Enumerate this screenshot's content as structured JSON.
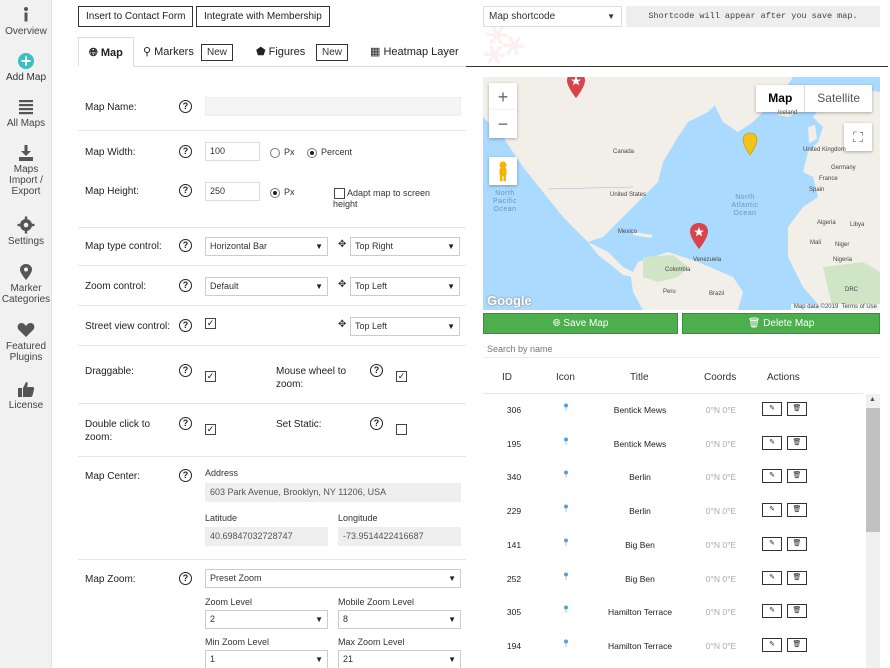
{
  "sidebar": {
    "items": [
      {
        "label": "Overview",
        "icon": "info-icon"
      },
      {
        "label": "Add Map",
        "icon": "plus-circle-icon"
      },
      {
        "label": "All Maps",
        "icon": "list-icon"
      },
      {
        "label": "Maps Import / Export",
        "icon": "download-icon"
      },
      {
        "label": "Settings",
        "icon": "gear-icon"
      },
      {
        "label": "Marker Categories",
        "icon": "map-marker-icon"
      },
      {
        "label": "Featured Plugins",
        "icon": "heart-icon"
      },
      {
        "label": "License",
        "icon": "thumbs-up-icon"
      }
    ]
  },
  "toolbar": {
    "insert_contact_form": "Insert to Contact Form",
    "integrate_membership": "Integrate with Membership"
  },
  "tabs": {
    "map": "Map",
    "markers": "Markers",
    "markers_new": "New",
    "figures": "Figures",
    "figures_new": "New",
    "heatmap": "Heatmap Layer"
  },
  "form": {
    "map_name_label": "Map Name:",
    "map_name_value": "",
    "map_width_label": "Map Width:",
    "map_width_value": "100",
    "map_width_px": "Px",
    "map_width_percent": "Percent",
    "map_height_label": "Map Height:",
    "map_height_value": "250",
    "map_height_px": "Px",
    "adapt_map": "Adapt map to screen height",
    "map_type_control_label": "Map type control:",
    "map_type_control_value": "Horizontal Bar",
    "map_type_control_pos": "Top Right",
    "zoom_control_label": "Zoom control:",
    "zoom_control_value": "Default",
    "zoom_control_pos": "Top Left",
    "street_view_label": "Street view control:",
    "street_view_pos": "Top Left",
    "draggable_label": "Draggable:",
    "mouse_wheel_label": "Mouse wheel to zoom:",
    "double_click_label": "Double click to zoom:",
    "set_static_label": "Set Static:",
    "map_center_label": "Map Center:",
    "address_label": "Address",
    "address_value": "603 Park Avenue, Brooklyn, NY 11206, USA",
    "latitude_label": "Latitude",
    "latitude_value": "40.69847032728747",
    "longitude_label": "Longitude",
    "longitude_value": "-73.9514422416687",
    "map_zoom_label": "Map Zoom:",
    "map_zoom_value": "Preset Zoom",
    "zoom_level_label": "Zoom Level",
    "zoom_level_value": "2",
    "mobile_zoom_label": "Mobile Zoom Level",
    "mobile_zoom_value": "8",
    "min_zoom_label": "Min Zoom Level",
    "min_zoom_value": "1",
    "max_zoom_label": "Max Zoom Level",
    "max_zoom_value": "21",
    "help": "?"
  },
  "right": {
    "shortcode_select": "Map shortcode",
    "shortcode_note": "Shortcode will appear after you save map.",
    "map_btn": "Map",
    "satellite_btn": "Satellite",
    "zoom_in": "+",
    "zoom_out": "−",
    "fullscreen": "⛶",
    "ocean_pacific": "North Pacific Ocean",
    "ocean_atlantic": "North Atlantic Ocean",
    "labels": {
      "iceland": "Iceland",
      "canada": "Canada",
      "us": "United States",
      "mexico": "Mexico",
      "venezuela": "Venezuela",
      "colombia": "Colombia",
      "peru": "Peru",
      "brazil": "Brazil",
      "uk": "United Kingdom",
      "germany": "Germany",
      "france": "France",
      "spain": "Spain",
      "algeria": "Algeria",
      "libya": "Libya",
      "mali": "Mali",
      "niger": "Niger",
      "nigeria": "Nigeria",
      "drc": "DRC",
      "google": "Google",
      "mapdata": "Map data ©2019",
      "terms": "Terms of Use"
    },
    "save_map": "Save Map",
    "delete_map": "Delete Map",
    "search_placeholder": "Search by name"
  },
  "table": {
    "headers": [
      "ID",
      "Icon",
      "Title",
      "Coords",
      "Actions"
    ],
    "rows": [
      {
        "id": "306",
        "title": "Bentick Mews",
        "coords": "0°N 0°E"
      },
      {
        "id": "195",
        "title": "Bentick Mews",
        "coords": "0°N 0°E"
      },
      {
        "id": "340",
        "title": "Berlin",
        "coords": "0°N 0°E"
      },
      {
        "id": "229",
        "title": "Berlin",
        "coords": "0°N 0°E"
      },
      {
        "id": "141",
        "title": "Big Ben",
        "coords": "0°N 0°E"
      },
      {
        "id": "252",
        "title": "Big Ben",
        "coords": "0°N 0°E"
      },
      {
        "id": "305",
        "title": "Hamilton Terrace",
        "coords": "0°N 0°E"
      },
      {
        "id": "194",
        "title": "Hamilton Terrace",
        "coords": "0°N 0°E"
      }
    ]
  },
  "colors": {
    "green": "#4cae4c",
    "map_water": "#aadaff",
    "map_land": "#f2efe9",
    "marker_red": "#d9434c",
    "marker_yellow": "#f0c419",
    "accent_teal": "#39c0c0"
  }
}
